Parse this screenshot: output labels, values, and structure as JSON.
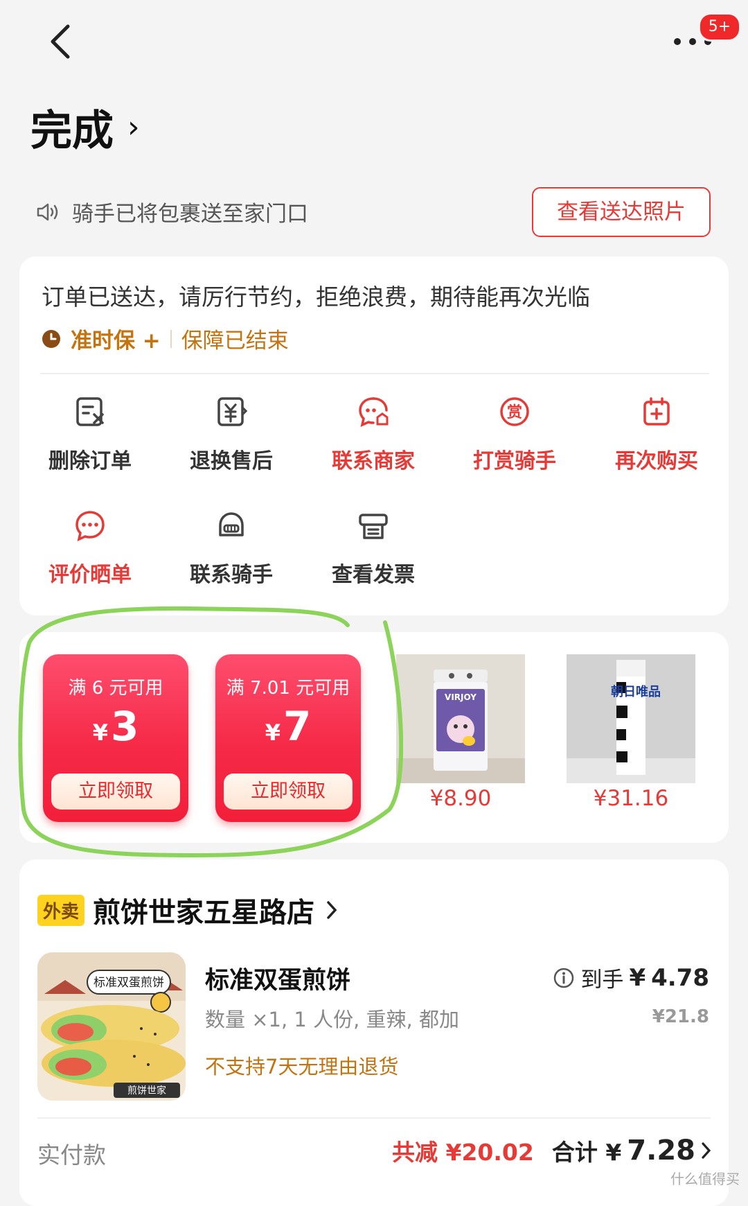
{
  "nav": {
    "badge": "5+"
  },
  "status": {
    "title": "完成",
    "chevron": "›"
  },
  "delivery_notice": {
    "text": "骑手已将包裹送至家门口",
    "photo_button": "查看送达照片"
  },
  "order_card": {
    "message": "订单已送达，请厉行节约，拒绝浪费，期待能再次光临",
    "guarantee_label": "准时保 +",
    "guarantee_status": "保障已结束",
    "actions": [
      {
        "label": "删除订单",
        "icon": "delete-order-icon"
      },
      {
        "label": "退换售后",
        "icon": "refund-icon"
      },
      {
        "label": "联系商家",
        "icon": "contact-merchant-icon"
      },
      {
        "label": "打赏骑手",
        "icon": "tip-rider-icon"
      },
      {
        "label": "再次购买",
        "icon": "buy-again-icon"
      },
      {
        "label": "评价晒单",
        "icon": "review-icon"
      },
      {
        "label": "联系骑手",
        "icon": "contact-rider-icon"
      },
      {
        "label": "查看发票",
        "icon": "invoice-icon"
      }
    ]
  },
  "recommend": {
    "coupons": [
      {
        "condition": "满 6 元可用",
        "currency": "¥",
        "amount": "3",
        "button": "立即领取"
      },
      {
        "condition": "满 7.01 元可用",
        "currency": "¥",
        "amount": "7",
        "button": "立即领取"
      }
    ],
    "products": [
      {
        "price": "¥8.90",
        "brand": "VIRJOY"
      },
      {
        "price": "¥31.16",
        "brand": "朝日唯品"
      }
    ]
  },
  "order_detail": {
    "tag": "外卖",
    "shop_name": "煎饼世家五星路店",
    "item": {
      "name": "标准双蛋煎饼",
      "spec": "数量 ×1, 1 人份, 重辣, 都加",
      "note": "不支持7天无理由退货",
      "final_label": "到手",
      "final_currency": "¥",
      "final_value": "4.78",
      "original_price": "¥21.8",
      "image_label": "标准双蛋煎饼",
      "image_footer": "煎饼世家"
    },
    "paid_label": "实付款",
    "discount": "共减 ¥20.02",
    "total_label": "合计 ¥",
    "total_value": "7.28"
  },
  "watermark": "什么值得买",
  "colors": {
    "accent": "#e53a36",
    "gold": "#c5730e",
    "coupon": "#f52a47",
    "highlight_loop": "#8cd35a"
  }
}
